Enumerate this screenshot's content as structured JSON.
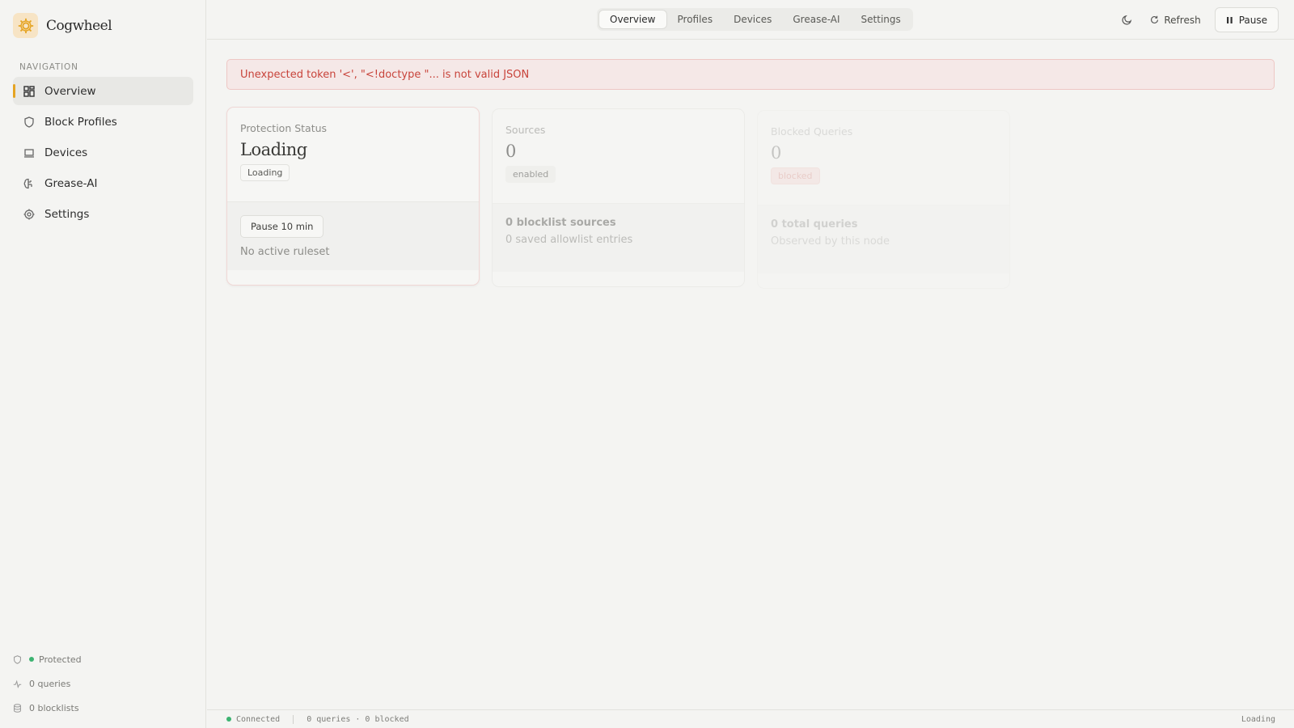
{
  "brand": {
    "name": "Cogwheel"
  },
  "sidebar": {
    "heading": "NAVIGATION",
    "items": [
      {
        "label": "Overview",
        "icon": "grid-icon"
      },
      {
        "label": "Block Profiles",
        "icon": "shield-icon"
      },
      {
        "label": "Devices",
        "icon": "laptop-icon"
      },
      {
        "label": "Grease-AI",
        "icon": "brain-icon"
      },
      {
        "label": "Settings",
        "icon": "gear-icon"
      }
    ],
    "footer": {
      "protected": "Protected",
      "queries": "0 queries",
      "blocklists": "0 blocklists"
    }
  },
  "topbar": {
    "tabs": [
      "Overview",
      "Profiles",
      "Devices",
      "Grease-AI",
      "Settings"
    ],
    "refresh_label": "Refresh",
    "pause_label": "Pause"
  },
  "error": "Unexpected token '<', \"<!doctype \"... is not valid JSON",
  "cards": {
    "protection": {
      "label": "Protection Status",
      "value": "Loading",
      "badge": "Loading",
      "button": "Pause 10 min",
      "sub": "No active ruleset"
    },
    "sources": {
      "label": "Sources",
      "value": "0",
      "badge": "enabled",
      "line1": "0 blocklist sources",
      "line2": "0 saved allowlist entries"
    },
    "blocked": {
      "label": "Blocked Queries",
      "value": "0",
      "badge": "blocked",
      "line1": "0 total queries",
      "line2": "Observed by this node"
    }
  },
  "statusbar": {
    "connection": "Connected",
    "summary": "0 queries · 0 blocked",
    "right": "Loading"
  },
  "colors": {
    "accent": "#e5a423",
    "error": "#c8443b",
    "ok": "#3cb371"
  }
}
